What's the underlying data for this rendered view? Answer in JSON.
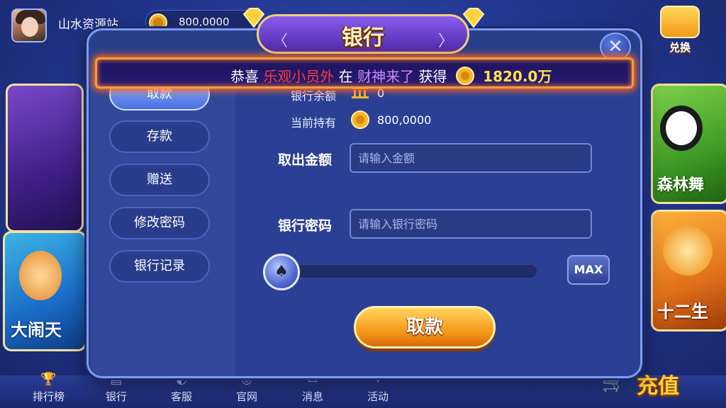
{
  "app": {
    "site_name": "山水资源站",
    "coins": "800,0000",
    "exchange_label": "兑换"
  },
  "side_tiles": {
    "left_bottom": "大闹天",
    "right_top": "森林舞",
    "right_bottom": "十二生"
  },
  "dialog": {
    "title": "银行",
    "menu": [
      {
        "label": "取款",
        "active": true
      },
      {
        "label": "存款",
        "active": false
      },
      {
        "label": "赠送",
        "active": false
      },
      {
        "label": "修改密码",
        "active": false
      },
      {
        "label": "银行记录",
        "active": false
      }
    ],
    "bank_balance_label": "银行余额",
    "bank_balance_value": "0",
    "current_label": "当前持有",
    "current_value": "800,0000",
    "amount_label": "取出金额",
    "amount_placeholder": "请输入金额",
    "password_label": "银行密码",
    "password_placeholder": "请输入银行密码",
    "slider_level": 0,
    "max_label": "MAX",
    "submit_label": "取款"
  },
  "marquee": {
    "prefix": "恭喜",
    "user": "乐观小员外",
    "mid": "在",
    "game": "财神来了",
    "post": "获得",
    "amount": "1820.0万"
  },
  "bottom_nav": [
    {
      "label": "排行榜",
      "icon": "trophy-icon"
    },
    {
      "label": "银行",
      "icon": "bank-icon"
    },
    {
      "label": "客服",
      "icon": "headset-icon"
    },
    {
      "label": "官网",
      "icon": "globe-icon"
    },
    {
      "label": "消息",
      "icon": "message-icon"
    },
    {
      "label": "活动",
      "icon": "gift-icon"
    }
  ],
  "recharge_label": "充值",
  "colors": {
    "marquee_user": "#ff3b3b",
    "marquee_game": "#c88bff",
    "marquee_amount": "#ffe24a",
    "primary_button": "#f79a1c",
    "dialog_bg": "#2a3f8c"
  }
}
